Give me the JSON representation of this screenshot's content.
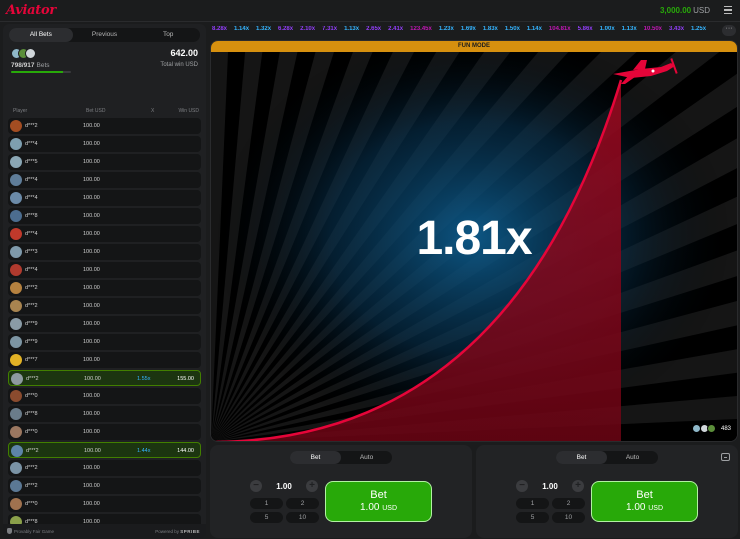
{
  "app": {
    "logo": "Aviator",
    "balance": "3,000.00",
    "currency": "USD"
  },
  "colors": {
    "brand_red": "#e50539",
    "green": "#28a909",
    "fun_banner": "#d6900f",
    "x_blue": "#34b4ff",
    "x_purple": "#913ef8",
    "x_pink": "#c017b4"
  },
  "bets_panel": {
    "tabs": [
      "All Bets",
      "Previous",
      "Top"
    ],
    "active_tab": "All Bets",
    "bets_count": "798/917",
    "bets_label": "Bets",
    "bets_progress": 0.87,
    "total_win": "642.00",
    "total_win_label": "Total win USD",
    "columns": {
      "player": "Player",
      "bet": "Bet USD",
      "x": "X",
      "win": "Win USD"
    },
    "rows": [
      {
        "player": "d***2",
        "bet": "100.00",
        "x": "",
        "win": "",
        "avatar_color": "#a34d22"
      },
      {
        "player": "d***4",
        "bet": "100.00",
        "x": "",
        "win": "",
        "avatar_color": "#7e9fb0"
      },
      {
        "player": "d***5",
        "bet": "100.00",
        "x": "",
        "win": "",
        "avatar_color": "#8aa6b4"
      },
      {
        "player": "d***4",
        "bet": "100.00",
        "x": "",
        "win": "",
        "avatar_color": "#5f7d99"
      },
      {
        "player": "d***4",
        "bet": "100.00",
        "x": "",
        "win": "",
        "avatar_color": "#6b8aa8"
      },
      {
        "player": "d***8",
        "bet": "100.00",
        "x": "",
        "win": "",
        "avatar_color": "#4c6d8f"
      },
      {
        "player": "d***4",
        "bet": "100.00",
        "x": "",
        "win": "",
        "avatar_color": "#c0392b"
      },
      {
        "player": "d***3",
        "bet": "100.00",
        "x": "",
        "win": "",
        "avatar_color": "#7f9aab"
      },
      {
        "player": "d***4",
        "bet": "100.00",
        "x": "",
        "win": "",
        "avatar_color": "#b03a2e"
      },
      {
        "player": "d***2",
        "bet": "100.00",
        "x": "",
        "win": "",
        "avatar_color": "#b5813f"
      },
      {
        "player": "d***2",
        "bet": "100.00",
        "x": "",
        "win": "",
        "avatar_color": "#a88450"
      },
      {
        "player": "d***9",
        "bet": "100.00",
        "x": "",
        "win": "",
        "avatar_color": "#8a9ba6"
      },
      {
        "player": "d***9",
        "bet": "100.00",
        "x": "",
        "win": "",
        "avatar_color": "#7d95a3"
      },
      {
        "player": "d***7",
        "bet": "100.00",
        "x": "",
        "win": "",
        "avatar_color": "#e2b225"
      },
      {
        "player": "d***2",
        "bet": "100.00",
        "x": "1.55x",
        "win": "155.00",
        "avatar_color": "#8e9aa0",
        "won": true
      },
      {
        "player": "d***0",
        "bet": "100.00",
        "x": "",
        "win": "",
        "avatar_color": "#8a4b2e"
      },
      {
        "player": "d***8",
        "bet": "100.00",
        "x": "",
        "win": "",
        "avatar_color": "#6a7c8a"
      },
      {
        "player": "d***0",
        "bet": "100.00",
        "x": "",
        "win": "",
        "avatar_color": "#9b7760"
      },
      {
        "player": "d***2",
        "bet": "100.00",
        "x": "1.44x",
        "win": "144.00",
        "avatar_color": "#5d84a8",
        "won": true
      },
      {
        "player": "d***2",
        "bet": "100.00",
        "x": "",
        "win": "",
        "avatar_color": "#7a93a5"
      },
      {
        "player": "d***2",
        "bet": "100.00",
        "x": "",
        "win": "",
        "avatar_color": "#5b7894"
      },
      {
        "player": "d***0",
        "bet": "100.00",
        "x": "",
        "win": "",
        "avatar_color": "#a0724f"
      },
      {
        "player": "d***8",
        "bet": "100.00",
        "x": "",
        "win": "",
        "avatar_color": "#8aa04a"
      },
      {
        "player": "d***8",
        "bet": "100.00",
        "x": "",
        "win": "",
        "avatar_color": "#9a6a55"
      }
    ],
    "footer_left": "Provably Fair Game",
    "footer_powered": "Powered by",
    "footer_brand": "SPRIBE"
  },
  "history": [
    {
      "v": "8.28x",
      "c": "#913ef8"
    },
    {
      "v": "1.14x",
      "c": "#34b4ff"
    },
    {
      "v": "1.32x",
      "c": "#34b4ff"
    },
    {
      "v": "6.28x",
      "c": "#913ef8"
    },
    {
      "v": "2.10x",
      "c": "#913ef8"
    },
    {
      "v": "7.31x",
      "c": "#913ef8"
    },
    {
      "v": "1.13x",
      "c": "#34b4ff"
    },
    {
      "v": "2.65x",
      "c": "#913ef8"
    },
    {
      "v": "2.41x",
      "c": "#913ef8"
    },
    {
      "v": "123.45x",
      "c": "#c017b4"
    },
    {
      "v": "1.23x",
      "c": "#34b4ff"
    },
    {
      "v": "1.69x",
      "c": "#34b4ff"
    },
    {
      "v": "1.83x",
      "c": "#34b4ff"
    },
    {
      "v": "1.50x",
      "c": "#34b4ff"
    },
    {
      "v": "1.14x",
      "c": "#34b4ff"
    },
    {
      "v": "104.81x",
      "c": "#c017b4"
    },
    {
      "v": "5.86x",
      "c": "#913ef8"
    },
    {
      "v": "1.00x",
      "c": "#34b4ff"
    },
    {
      "v": "1.13x",
      "c": "#34b4ff"
    },
    {
      "v": "10.50x",
      "c": "#c017b4"
    },
    {
      "v": "3.43x",
      "c": "#913ef8"
    },
    {
      "v": "1.25x",
      "c": "#34b4ff"
    }
  ],
  "history_more": "···",
  "game": {
    "mode_banner": "FUN MODE",
    "multiplier": "1.81x",
    "online_count": "483"
  },
  "bet_panels": [
    {
      "tabs": [
        "Bet",
        "Auto"
      ],
      "active_tab": "Bet",
      "amount": "1.00",
      "minus": "−",
      "plus": "+",
      "quick": [
        "1",
        "2",
        "5",
        "10"
      ],
      "button_label": "Bet",
      "button_amount": "1.00",
      "button_currency": "USD"
    },
    {
      "tabs": [
        "Bet",
        "Auto"
      ],
      "active_tab": "Bet",
      "amount": "1.00",
      "minus": "−",
      "plus": "+",
      "quick": [
        "1",
        "2",
        "5",
        "10"
      ],
      "button_label": "Bet",
      "button_amount": "1.00",
      "button_currency": "USD"
    }
  ]
}
